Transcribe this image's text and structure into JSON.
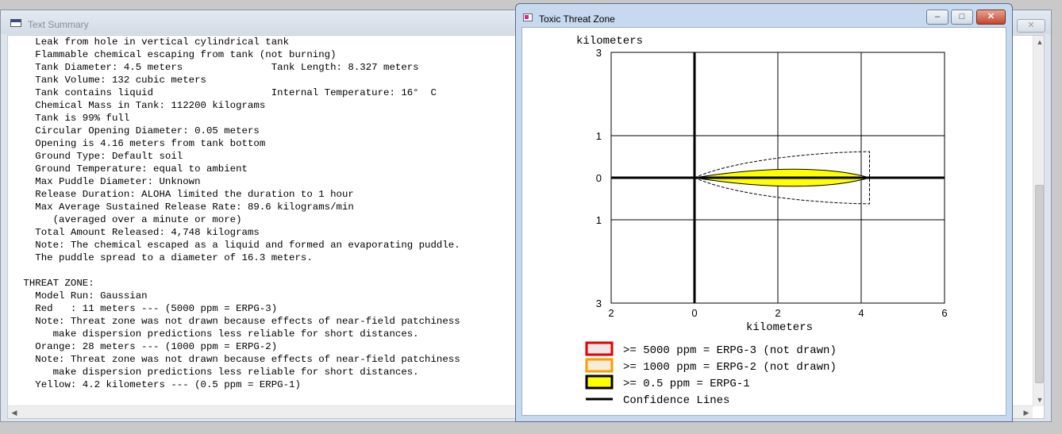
{
  "text_summary": {
    "title": "Text Summary",
    "close_glyph": "✕",
    "lines": [
      "   Leak from hole in vertical cylindrical tank",
      "   Flammable chemical escaping from tank (not burning)",
      "   Tank Diameter: 4.5 meters               Tank Length: 8.327 meters",
      "   Tank Volume: 132 cubic meters",
      "   Tank contains liquid                    Internal Temperature: 16°  C",
      "   Chemical Mass in Tank: 112200 kilograms",
      "   Tank is 99% full",
      "   Circular Opening Diameter: 0.05 meters",
      "   Opening is 4.16 meters from tank bottom",
      "   Ground Type: Default soil",
      "   Ground Temperature: equal to ambient",
      "   Max Puddle Diameter: Unknown",
      "   Release Duration: ALOHA limited the duration to 1 hour",
      "   Max Average Sustained Release Rate: 89.6 kilograms/min",
      "      (averaged over a minute or more)",
      "   Total Amount Released: 4,748 kilograms",
      "   Note: The chemical escaped as a liquid and formed an evaporating puddle.",
      "   The puddle spread to a diameter of 16.3 meters.",
      "",
      " THREAT ZONE:",
      "   Model Run: Gaussian",
      "   Red   : 11 meters --- (5000 ppm = ERPG-3)",
      "   Note: Threat zone was not drawn because effects of near-field patchiness",
      "      make dispersion predictions less reliable for short distances.",
      "   Orange: 28 meters --- (1000 ppm = ERPG-2)",
      "   Note: Threat zone was not drawn because effects of near-field patchiness",
      "      make dispersion predictions less reliable for short distances.",
      "   Yellow: 4.2 kilometers --- (0.5 ppm = ERPG-1)"
    ],
    "scroll_up_icon": "▲",
    "scroll_down_icon": "▼",
    "scroll_left_icon": "◀",
    "scroll_right_icon": "▶"
  },
  "threat_window": {
    "title": "Toxic Threat Zone",
    "minimize_glyph": "–",
    "maximize_glyph": "□",
    "close_glyph": "✕"
  },
  "chart_data": {
    "type": "area",
    "ylabel": "kilometers",
    "xlabel": "kilometers",
    "x_ticks": [
      "2",
      "0",
      "2",
      "4",
      "6"
    ],
    "y_ticks": [
      "3",
      "1",
      "0",
      "1",
      "3"
    ],
    "xlim": [
      -2,
      6
    ],
    "ylim": [
      -3,
      3
    ],
    "x_tick_values": [
      -2,
      0,
      2,
      4,
      6
    ],
    "y_tick_values": [
      3,
      1,
      0,
      -1,
      -3
    ],
    "grid": true,
    "colors": {
      "yellow_zone": "#ffff00",
      "orange_zone": "#f5a000",
      "red_zone": "#e00000",
      "confidence": "#000000"
    },
    "series": [
      {
        "name": ">= 0.5 ppm = ERPG-1",
        "type": "filled_zone",
        "length_km": 4.2,
        "max_halfwidth_km": 0.27
      },
      {
        "name": "Confidence Lines",
        "type": "dashed_envelope",
        "length_km": 4.2,
        "max_halfwidth_km": 0.62
      }
    ],
    "legend": [
      {
        "label": ">= 5000 ppm = ERPG-3 (not drawn)",
        "swatch": "red-dotted"
      },
      {
        "label": ">= 1000 ppm = ERPG-2 (not drawn)",
        "swatch": "orange-dotted"
      },
      {
        "label": ">= 0.5 ppm = ERPG-1",
        "swatch": "yellow"
      },
      {
        "label": "Confidence Lines",
        "swatch": "line"
      }
    ]
  }
}
